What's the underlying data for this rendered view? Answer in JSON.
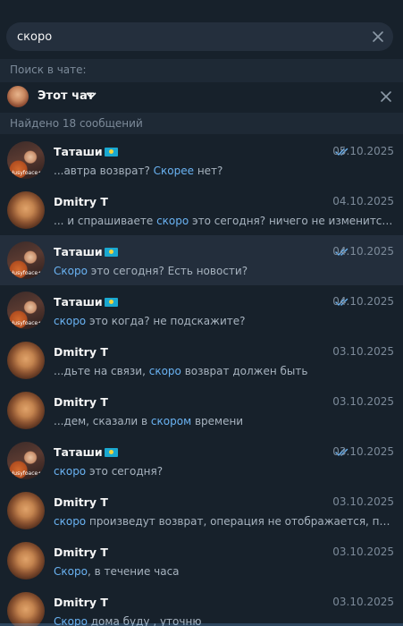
{
  "search": {
    "value": "скоро"
  },
  "scope": {
    "label": "Поиск в чате:",
    "chat_name": "Этот чат"
  },
  "found_label": "Найдено 18 сообщений",
  "results": [
    {
      "type": "tatashi",
      "name": "Таташи",
      "flag": "kz",
      "read": true,
      "date": "05.10.2025",
      "pre": "...автра возврат? ",
      "hl": "Скорее",
      "post": " нет?",
      "active": false,
      "avatar_caption": "Husyfoace+"
    },
    {
      "type": "dmitry",
      "name": "Dmitry T",
      "flag": "",
      "read": false,
      "date": "04.10.2025",
      "pre": "... и спрашиваете ",
      "hl": "скоро",
      "post": " это сегодня? ничего не изменится, ничего...",
      "active": false,
      "avatar_caption": ""
    },
    {
      "type": "tatashi",
      "name": "Таташи",
      "flag": "kz",
      "read": true,
      "date": "04.10.2025",
      "pre": "",
      "hl": "Скоро",
      "post": " это сегодня? Есть новости?",
      "active": true,
      "avatar_caption": "Husyfoace+"
    },
    {
      "type": "tatashi",
      "name": "Таташи",
      "flag": "kz",
      "read": true,
      "date": "04.10.2025",
      "pre": "",
      "hl": "скоро",
      "post": " это когда? не подскажите?",
      "active": false,
      "avatar_caption": "Husyfoace+"
    },
    {
      "type": "dmitry",
      "name": "Dmitry T",
      "flag": "",
      "read": false,
      "date": "03.10.2025",
      "pre": "...дьте на связи, ",
      "hl": "скоро",
      "post": " возврат должен быть",
      "active": false,
      "avatar_caption": ""
    },
    {
      "type": "dmitry",
      "name": "Dmitry T",
      "flag": "",
      "read": false,
      "date": "03.10.2025",
      "pre": "...дем, сказали в ",
      "hl": "скором",
      "post": " времени",
      "active": false,
      "avatar_caption": ""
    },
    {
      "type": "tatashi",
      "name": "Таташи",
      "flag": "kz",
      "read": true,
      "date": "03.10.2025",
      "pre": "",
      "hl": "скоро",
      "post": " это сегодня?",
      "active": false,
      "avatar_caption": "Husyfoace+"
    },
    {
      "type": "dmitry",
      "name": "Dmitry T",
      "flag": "",
      "read": false,
      "date": "03.10.2025",
      "pre": "",
      "hl": "скоро",
      "post": " произведут возврат, операция не отображается, потому чт...",
      "active": false,
      "avatar_caption": ""
    },
    {
      "type": "dmitry",
      "name": "Dmitry T",
      "flag": "",
      "read": false,
      "date": "03.10.2025",
      "pre": "",
      "hl": "Скоро",
      "post": ", в течение часа",
      "active": false,
      "avatar_caption": ""
    },
    {
      "type": "dmitry",
      "name": "Dmitry T",
      "flag": "",
      "read": false,
      "date": "03.10.2025",
      "pre": "",
      "hl": "Скоро",
      "post": " дома буду , уточню",
      "active": false,
      "avatar_caption": ""
    }
  ],
  "icons": {
    "clear": "close-icon",
    "chevron": "chevron-down-icon",
    "read": "double-check-icon"
  },
  "colors": {
    "background": "#17212b",
    "highlight": "#6ab3f3",
    "active_row": "#232e3c",
    "muted": "#7c8a99"
  }
}
